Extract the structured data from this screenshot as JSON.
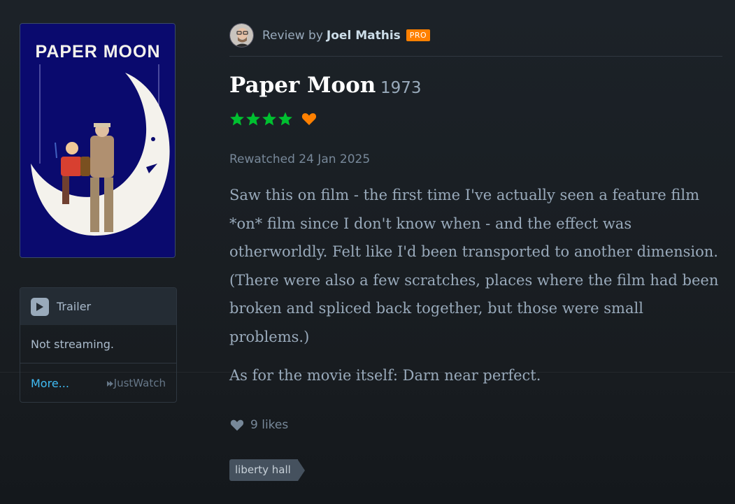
{
  "poster": {
    "title_text": "PAPER MOON",
    "colors": {
      "background": "#0a0a6e",
      "moon": "#f4f2ec"
    }
  },
  "watch": {
    "trailer_label": "Trailer",
    "streaming_status": "Not streaming.",
    "more_label": "More...",
    "provider_label": "JustWatch",
    "icons": {
      "trailer": "play-icon",
      "provider": "justwatch-logo-icon"
    }
  },
  "review": {
    "byline_prefix": "Review by",
    "author": "Joel Mathis",
    "badge": "PRO",
    "film_title": "Paper Moon",
    "film_year": "1973",
    "rating_stars": 4,
    "liked": true,
    "watched_line": "Rewatched 24 Jan 2025",
    "paragraphs": [
      "Saw this on film - the first time I've actually seen a feature film *on* film since I don't know when - and the effect was otherworldly. Felt like I'd been transported to another dimension. (There were also a few scratches, places where the film had been broken and spliced back together, but those were small problems.)",
      "As for the movie itself: Darn near perfect."
    ],
    "likes_label": "9 likes",
    "tags": [
      "liberty hall"
    ]
  },
  "colors": {
    "star": "#00c030",
    "liked_heart": "#ff8000",
    "pro_badge": "#ff8000",
    "link": "#40bcf4"
  }
}
